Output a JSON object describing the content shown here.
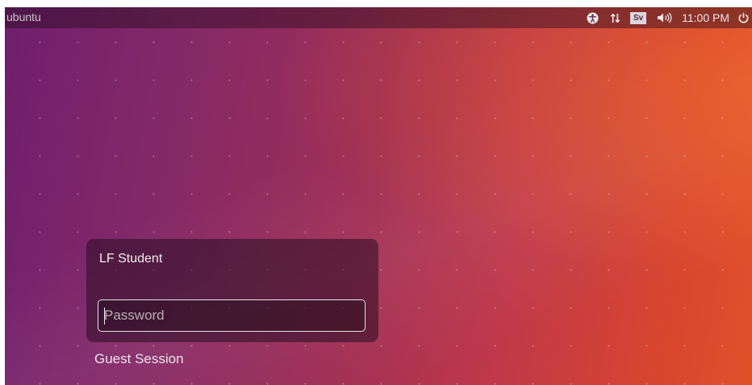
{
  "topbar": {
    "hostname": "ubuntu",
    "keyboard_layout": "Sv",
    "time": "11:00 PM",
    "icons": [
      "accessibility-icon",
      "network-icon",
      "keyboard-layout-icon",
      "volume-icon",
      "power-icon"
    ]
  },
  "login": {
    "user_name": "LF Student",
    "password_placeholder": "Password",
    "password_value": ""
  },
  "guest_session_label": "Guest Session",
  "colors": {
    "wallpaper_start": "#6f1e6e",
    "wallpaper_end": "#e2502a",
    "panel": "#2a0d24"
  }
}
